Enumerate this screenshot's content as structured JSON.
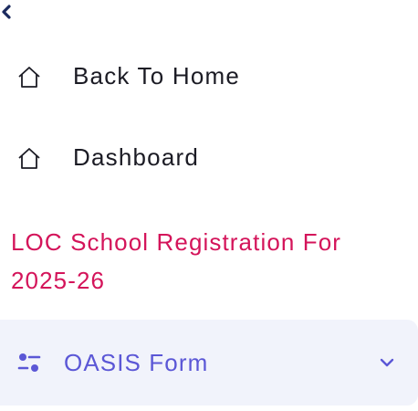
{
  "colors": {
    "accent_pink": "#d4145a",
    "accent_indigo": "#5b57d6",
    "text_dark": "#1b1b24",
    "group_bg": "#f1f3fb"
  },
  "sidebar": {
    "back_icon": "chevron-left-icon",
    "items": [
      {
        "label": "Back To Home",
        "icon": "home-icon"
      },
      {
        "label": "Dashboard",
        "icon": "home-icon"
      }
    ],
    "section_title": "LOC School Registration For 2025-26",
    "group": {
      "label": "OASIS Form",
      "icon": "toggle-settings-icon",
      "expand_icon": "chevron-down-icon"
    }
  }
}
